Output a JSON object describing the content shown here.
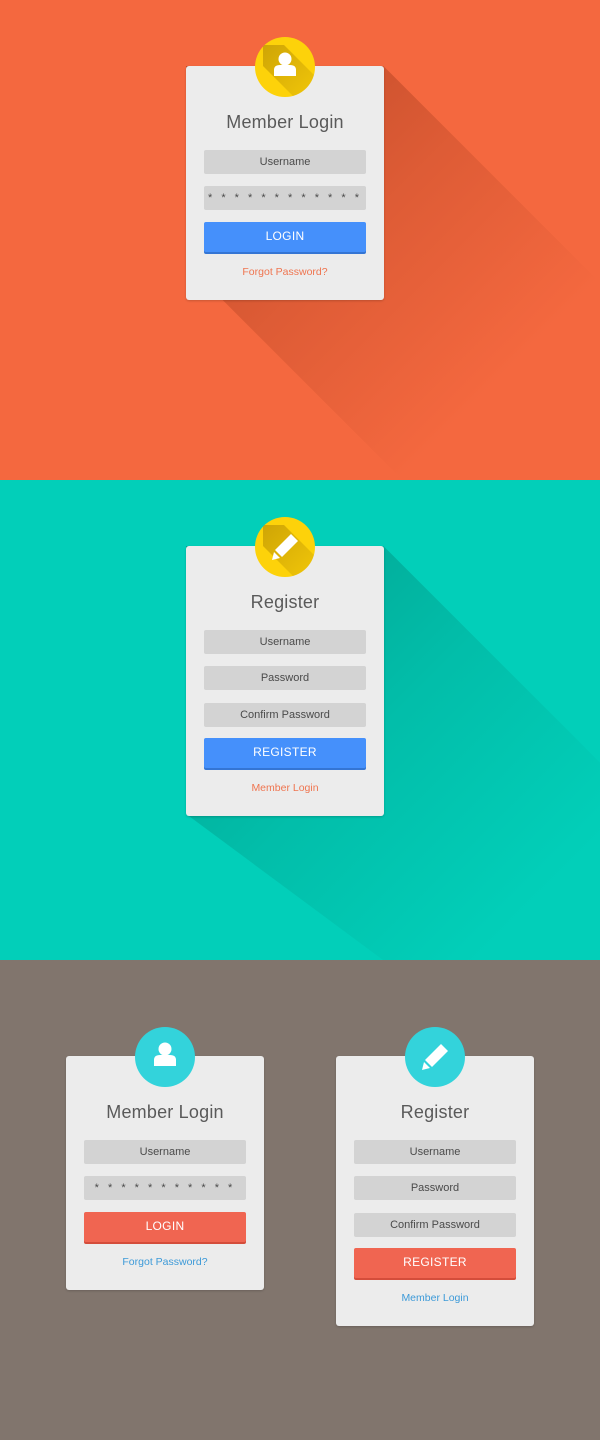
{
  "sections": [
    {
      "background": "#f4683f",
      "card": {
        "type": "login",
        "icon": "user-icon",
        "badge_color": "#fdd20a",
        "title": "Member Login",
        "username_placeholder": "Username",
        "password_value": "* * * * * * * * * * * *",
        "button_label": "LOGIN",
        "button_color": "#4590fb",
        "link_label": "Forgot Password?",
        "link_color": "#ef7550"
      }
    },
    {
      "background": "#02cfb9",
      "card": {
        "type": "register",
        "icon": "pencil-icon",
        "badge_color": "#fdd20a",
        "title": "Register",
        "username_placeholder": "Username",
        "password_placeholder": "Password",
        "confirm_placeholder": "Confirm Password",
        "button_label": "REGISTER",
        "button_color": "#4590fb",
        "link_label": "Member Login",
        "link_color": "#ef7550"
      }
    },
    {
      "background": "#81756d",
      "cards": [
        {
          "type": "login",
          "icon": "user-icon",
          "badge_color": "#33d3db",
          "title": "Member Login",
          "username_placeholder": "Username",
          "password_value": "* * * * * * * * * * *",
          "button_label": "LOGIN",
          "button_color": "#f06551",
          "link_label": "Forgot Password?",
          "link_color": "#3d9ad8"
        },
        {
          "type": "register",
          "icon": "pencil-icon",
          "badge_color": "#33d3db",
          "title": "Register",
          "username_placeholder": "Username",
          "password_placeholder": "Password",
          "confirm_placeholder": "Confirm Password",
          "button_label": "REGISTER",
          "button_color": "#f06551",
          "link_label": "Member Login",
          "link_color": "#3d9ad8"
        }
      ]
    }
  ]
}
